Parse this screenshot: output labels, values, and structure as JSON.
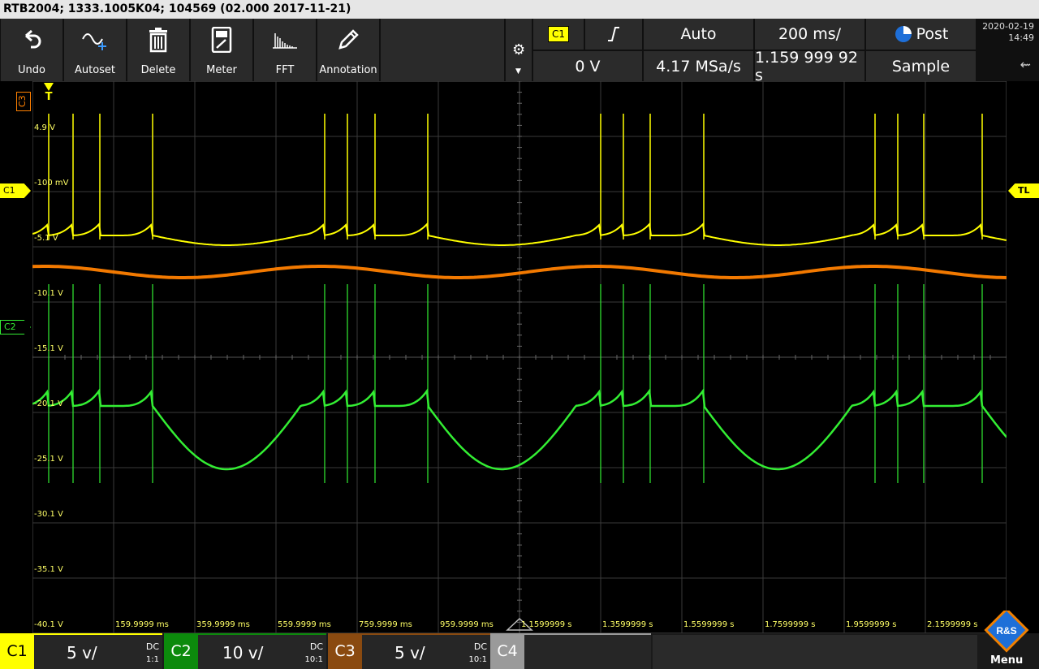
{
  "title": "RTB2004; 1333.1005K04; 104569 (02.000 2017-11-21)",
  "toolbar": {
    "buttons": [
      {
        "label": "Undo",
        "icon": "undo-icon"
      },
      {
        "label": "Autoset",
        "icon": "autoset-icon"
      },
      {
        "label": "Delete",
        "icon": "delete-icon"
      },
      {
        "label": "Meter",
        "icon": "meter-icon"
      },
      {
        "label": "FFT",
        "icon": "fft-icon"
      },
      {
        "label": "Annotation",
        "icon": "annotation-icon"
      }
    ]
  },
  "trigger": {
    "source": "C1",
    "slope": "ʃ",
    "mode": "Auto",
    "level": "0 V",
    "timebase": "200 ms/",
    "sample_rate": "4.17 MSa/s",
    "position": "1.159 999 92 s",
    "run_mode": "Post",
    "acq_mode": "Sample"
  },
  "clock": {
    "date": "2020-02-19",
    "time": "14:49"
  },
  "volt_labels": [
    "4.9 V",
    "-100 mV",
    "-5.1 V",
    "-10.1 V",
    "-15.1 V",
    "-20.1 V",
    "-25.1 V",
    "-30.1 V",
    "-35.1 V",
    "-40.1 V"
  ],
  "time_labels": [
    "159.9999 ms",
    "359.9999 ms",
    "559.9999 ms",
    "759.9999 ms",
    "959.9999 ms",
    "1.1599999 s",
    "1.3599999 s",
    "1.5599999 s",
    "1.7599999 s",
    "1.9599999 s",
    "2.1599999 s"
  ],
  "markers": {
    "c1": "C1",
    "c2": "C2",
    "c3": "C3",
    "trigger": "T",
    "trigger_level": "TL"
  },
  "channels": [
    {
      "name": "C1",
      "scale": "5 v/",
      "coupling": "DC",
      "probe": "1:1",
      "color": "#ffff00"
    },
    {
      "name": "C2",
      "scale": "10 v/",
      "coupling": "DC",
      "probe": "10:1",
      "color": "#00cc00"
    },
    {
      "name": "C3",
      "scale": "5 v/",
      "coupling": "DC",
      "probe": "10:1",
      "color": "#ff8000"
    },
    {
      "name": "C4",
      "color": "#c0c0c0"
    }
  ],
  "menu_label": "Menu",
  "logo_text": "R&S",
  "colors": {
    "c1": "#ffff00",
    "c2": "#33ee33",
    "c3": "#ff8000",
    "grid": "#3a3a3a"
  }
}
